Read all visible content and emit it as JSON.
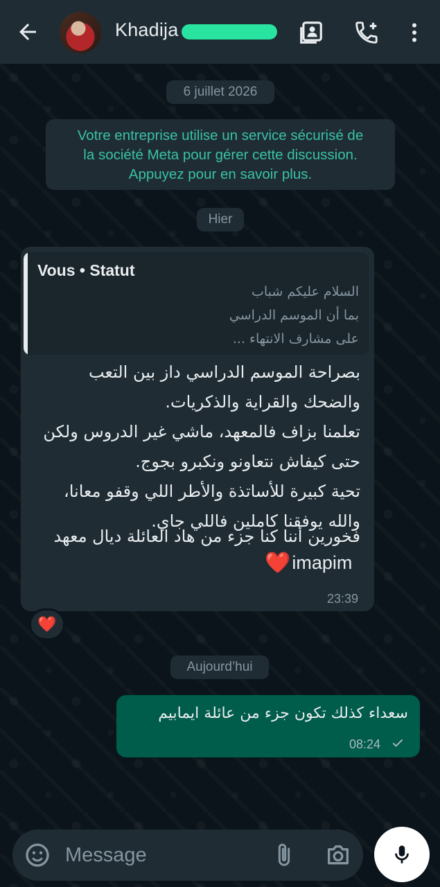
{
  "header": {
    "contact_name": "Khadija",
    "back_icon": "arrow-back-icon",
    "avatar": "contact-avatar",
    "icons": [
      "contact-card-icon",
      "add-call-icon",
      "more-vertical-icon"
    ]
  },
  "chips": {
    "date_1": "6 juillet 2026",
    "date_2": "Hier",
    "date_3": "Aujourd’hui"
  },
  "system_message": {
    "line1": "Votre entreprise utilise un service sécurisé de",
    "line2": "la société Meta pour gérer cette discussion.",
    "line3": "Appuyez pour en savoir plus."
  },
  "incoming": {
    "quote": {
      "author": "Vous • Statut",
      "lines": [
        "السلام عليكم شباب",
        "بما أن الموسم الدراسي",
        "على مشارف الانتهاء ..."
      ]
    },
    "lines": [
      "بصراحة الموسم الدراسي داز بين التعب",
      "والضحك والقراية والذكريات.",
      "تعلمنا بزاف فالمعهد، ماشي غير الدروس ولكن",
      "حتى كيفاش نتعاونو ونكبرو بجوج.",
      "تحية كبيرة للأساتذة والأطر اللي وقفو معانا،",
      "والله يوفقنا كاملين فاللي جاي.",
      "فخورين أننا كنا جزء من هاد العائلة ديال معهد"
    ],
    "last_word": "imapim",
    "emoji": "❤️",
    "time": "23:39",
    "reaction": "❤️"
  },
  "outgoing": {
    "text": "سعداء كذلك تكون جزء من عائلة ايمابيم",
    "time": "08:24",
    "status_icon": "check-icon"
  },
  "composer": {
    "placeholder": "Message",
    "icons": [
      "sticker-icon",
      "attach-icon",
      "camera-icon",
      "mic-icon"
    ]
  },
  "colors": {
    "background": "#0b141a",
    "header": "#1f2c34",
    "incoming_bubble": "#1f2c34",
    "outgoing_bubble": "#005c4b",
    "system_text": "#39c2a6",
    "redaction": "#29e3a1"
  }
}
